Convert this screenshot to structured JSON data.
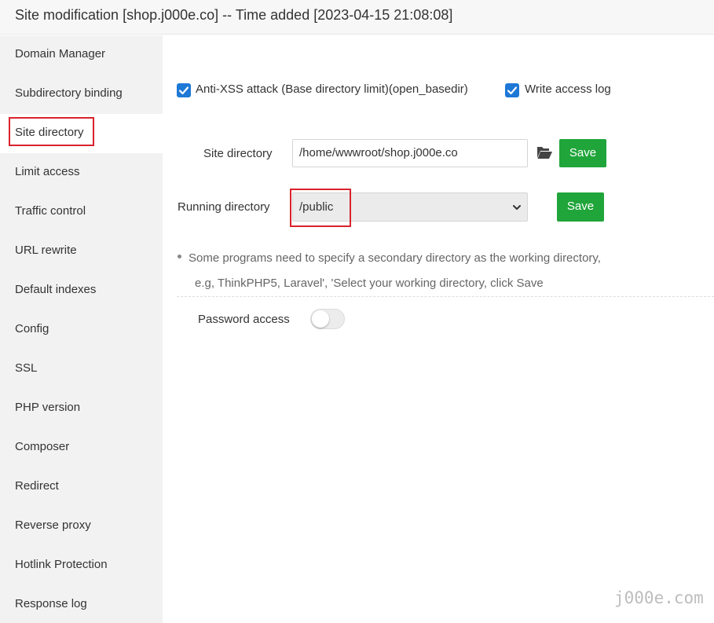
{
  "window": {
    "title": "Site modification [shop.j000e.co] -- Time added [2023-04-15 21:08:08]"
  },
  "sidebar": {
    "items": [
      {
        "label": "Domain Manager"
      },
      {
        "label": "Subdirectory binding"
      },
      {
        "label": "Site directory",
        "active": true
      },
      {
        "label": "Limit access"
      },
      {
        "label": "Traffic control"
      },
      {
        "label": "URL rewrite"
      },
      {
        "label": "Default indexes"
      },
      {
        "label": "Config"
      },
      {
        "label": "SSL"
      },
      {
        "label": "PHP version"
      },
      {
        "label": "Composer"
      },
      {
        "label": "Redirect"
      },
      {
        "label": "Reverse proxy"
      },
      {
        "label": "Hotlink Protection"
      },
      {
        "label": "Response log"
      }
    ]
  },
  "options": {
    "anti_xss_label": "Anti-XSS attack (Base directory limit)(open_basedir)",
    "anti_xss_checked": true,
    "write_log_label": "Write access log",
    "write_log_checked": true
  },
  "site_directory": {
    "label": "Site directory",
    "value": "/home/wwwroot/shop.j000e.co",
    "folder_icon": "folder-open-icon",
    "save_label": "Save"
  },
  "running_directory": {
    "label": "Running directory",
    "selected": "/public",
    "save_label": "Save"
  },
  "tips": {
    "line1": "Some programs need to specify a secondary directory as the working directory,",
    "line2": "e.g, ThinkPHP5, Laravel', 'Select your working directory, click Save"
  },
  "password_access": {
    "label": "Password access",
    "enabled": false
  },
  "watermark": "j000e.com",
  "colors": {
    "accent_blue": "#1e78d6",
    "save_green": "#20a53a",
    "highlight_red": "#d9232d",
    "sidebar_bg": "#f2f2f2"
  }
}
